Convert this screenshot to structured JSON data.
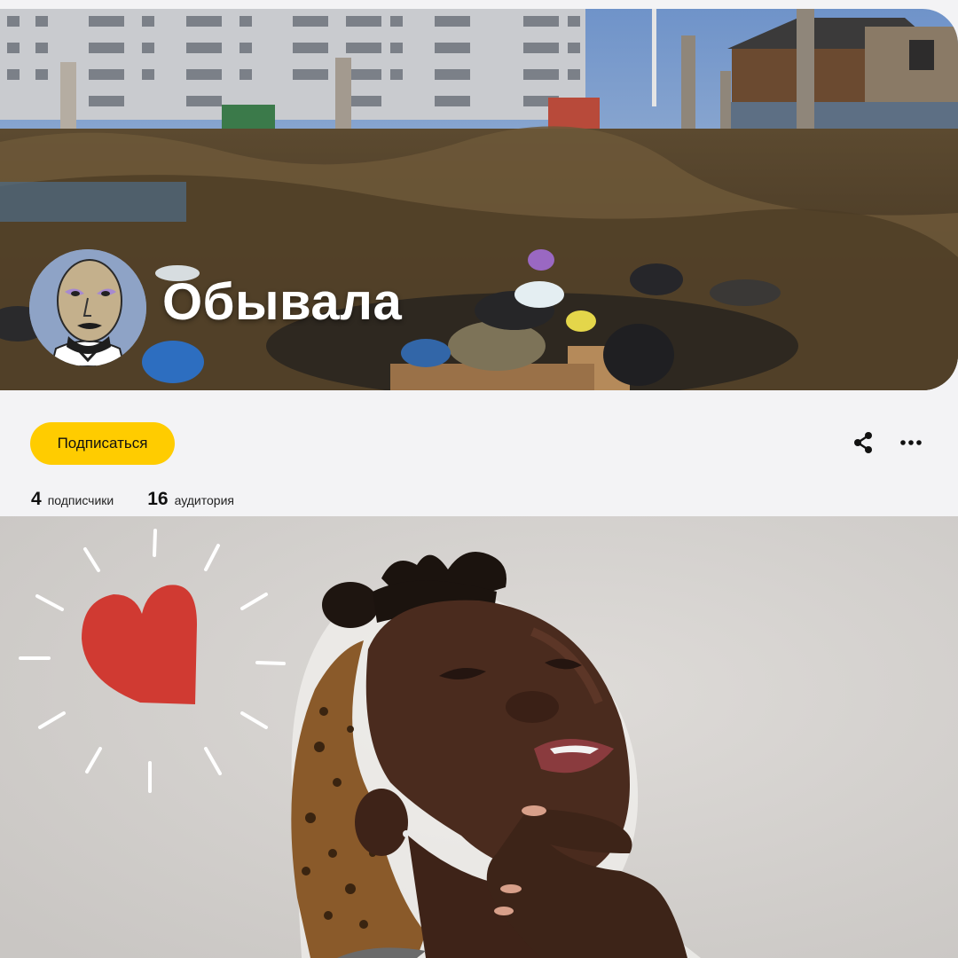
{
  "channel": {
    "name": "Обывала",
    "subscribe_label": "Подписаться",
    "stats": [
      {
        "value": "4",
        "label": "подписчики"
      },
      {
        "value": "16",
        "label": "аудитория"
      }
    ]
  },
  "icons": {
    "share": "share-icon",
    "more": "more-dots-icon",
    "heart": "heart-icon"
  },
  "colors": {
    "subscribe": "#ffcc00",
    "heart": "#d03a32",
    "background": "#f3f3f5"
  }
}
